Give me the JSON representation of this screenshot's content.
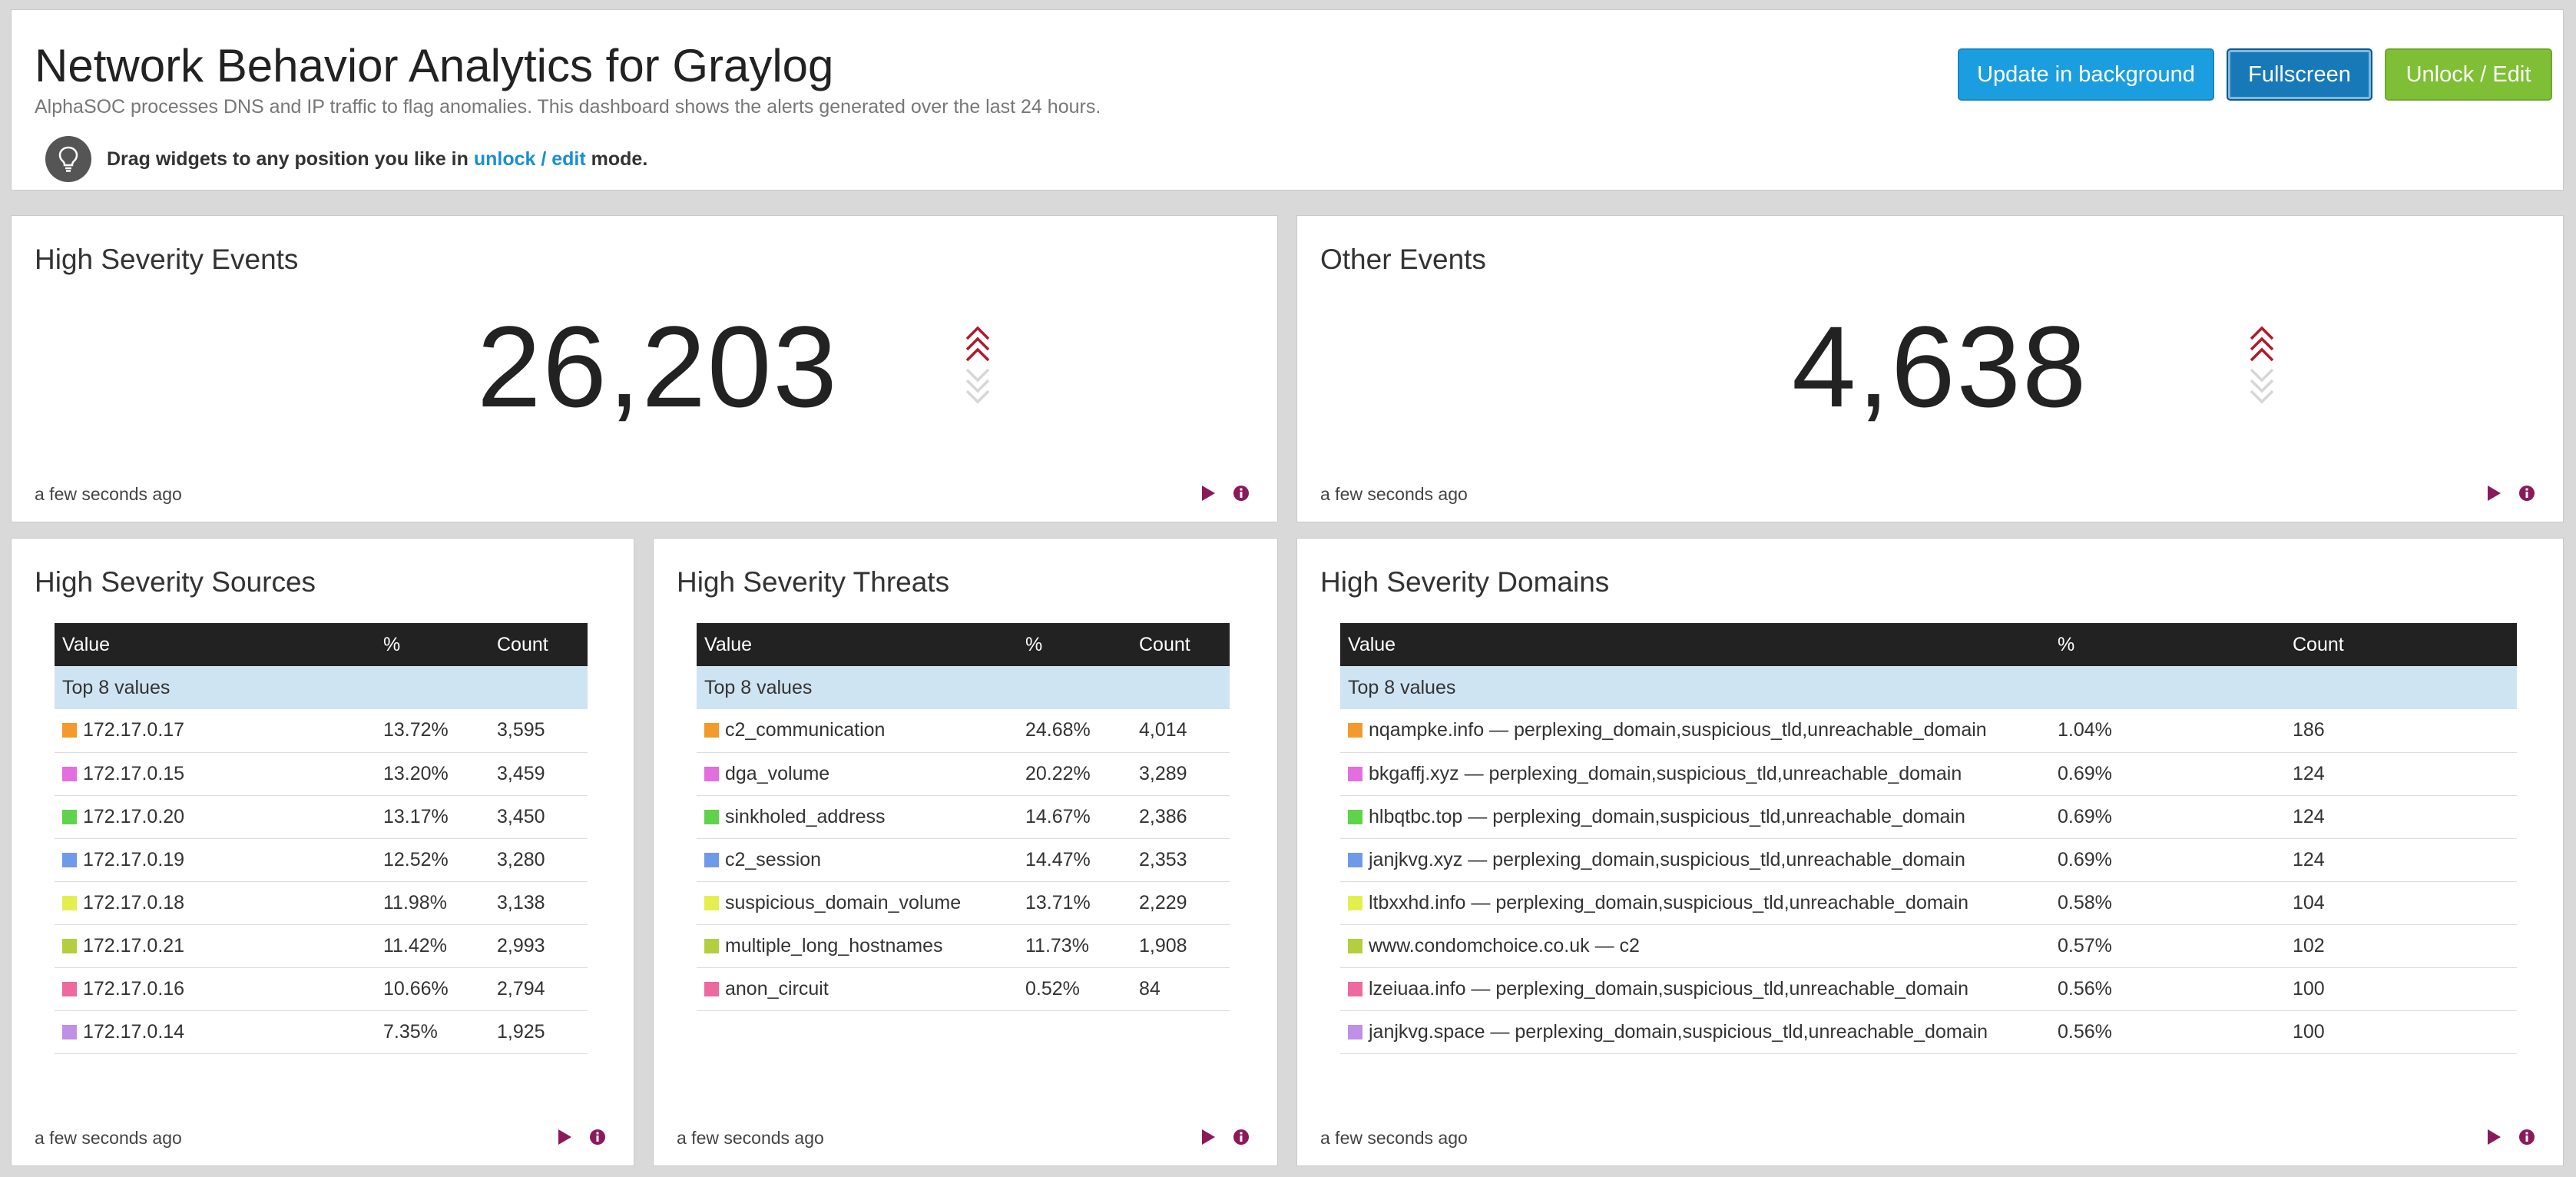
{
  "header": {
    "title": "Network Behavior Analytics for Graylog",
    "subtitle": "AlphaSOC processes DNS and IP traffic to flag anomalies. This dashboard shows the alerts generated over the last 24 hours.",
    "hint_prefix": "Drag widgets to any position you like in ",
    "hint_link": "unlock / edit",
    "hint_suffix": " mode.",
    "buttons": {
      "update": "Update in background",
      "fullscreen": "Fullscreen",
      "unlock": "Unlock / Edit"
    }
  },
  "colors": {
    "trend_up": "#b2182b",
    "action_icon": "#8a1a5a",
    "update_button": "#1b9ee0",
    "fullscreen_button": "#1779b8",
    "unlock_button": "#7fbf35"
  },
  "widgets": {
    "high_severity_events": {
      "title": "High Severity Events",
      "value": "26,203",
      "trend": "up",
      "footer": "a few seconds ago"
    },
    "other_events": {
      "title": "Other Events",
      "value": "4,638",
      "trend": "up",
      "footer": "a few seconds ago"
    },
    "high_severity_sources": {
      "title": "High Severity Sources",
      "columns": [
        "Value",
        "%",
        "Count"
      ],
      "group_label": "Top 8 values",
      "rows": [
        {
          "color": "#f39a2b",
          "value": "172.17.0.17",
          "pct": "13.72%",
          "count": "3,595"
        },
        {
          "color": "#e36ee0",
          "value": "172.17.0.15",
          "pct": "13.20%",
          "count": "3,459"
        },
        {
          "color": "#5fd34b",
          "value": "172.17.0.20",
          "pct": "13.17%",
          "count": "3,450"
        },
        {
          "color": "#6f9ae8",
          "value": "172.17.0.19",
          "pct": "12.52%",
          "count": "3,280"
        },
        {
          "color": "#e4ef4f",
          "value": "172.17.0.18",
          "pct": "11.98%",
          "count": "3,138"
        },
        {
          "color": "#b3cf3e",
          "value": "172.17.0.21",
          "pct": "11.42%",
          "count": "2,993"
        },
        {
          "color": "#ec6a9d",
          "value": "172.17.0.16",
          "pct": "10.66%",
          "count": "2,794"
        },
        {
          "color": "#c08fe6",
          "value": "172.17.0.14",
          "pct": "7.35%",
          "count": "1,925"
        }
      ],
      "footer": "a few seconds ago"
    },
    "high_severity_threats": {
      "title": "High Severity Threats",
      "columns": [
        "Value",
        "%",
        "Count"
      ],
      "group_label": "Top 8 values",
      "rows": [
        {
          "color": "#f39a2b",
          "value": "c2_communication",
          "pct": "24.68%",
          "count": "4,014"
        },
        {
          "color": "#e36ee0",
          "value": "dga_volume",
          "pct": "20.22%",
          "count": "3,289"
        },
        {
          "color": "#5fd34b",
          "value": "sinkholed_address",
          "pct": "14.67%",
          "count": "2,386"
        },
        {
          "color": "#6f9ae8",
          "value": "c2_session",
          "pct": "14.47%",
          "count": "2,353"
        },
        {
          "color": "#e4ef4f",
          "value": "suspicious_domain_volume",
          "pct": "13.71%",
          "count": "2,229"
        },
        {
          "color": "#b3cf3e",
          "value": "multiple_long_hostnames",
          "pct": "11.73%",
          "count": "1,908"
        },
        {
          "color": "#ec6a9d",
          "value": "anon_circuit",
          "pct": "0.52%",
          "count": "84"
        }
      ],
      "footer": "a few seconds ago"
    },
    "high_severity_domains": {
      "title": "High Severity Domains",
      "columns": [
        "Value",
        "%",
        "Count"
      ],
      "group_label": "Top 8 values",
      "rows": [
        {
          "color": "#f39a2b",
          "value": "nqampke.info — perplexing_domain,suspicious_tld,unreachable_domain",
          "pct": "1.04%",
          "count": "186"
        },
        {
          "color": "#e36ee0",
          "value": "bkgaffj.xyz — perplexing_domain,suspicious_tld,unreachable_domain",
          "pct": "0.69%",
          "count": "124"
        },
        {
          "color": "#5fd34b",
          "value": "hlbqtbc.top — perplexing_domain,suspicious_tld,unreachable_domain",
          "pct": "0.69%",
          "count": "124"
        },
        {
          "color": "#6f9ae8",
          "value": "janjkvg.xyz — perplexing_domain,suspicious_tld,unreachable_domain",
          "pct": "0.69%",
          "count": "124"
        },
        {
          "color": "#e4ef4f",
          "value": "ltbxxhd.info — perplexing_domain,suspicious_tld,unreachable_domain",
          "pct": "0.58%",
          "count": "104"
        },
        {
          "color": "#b3cf3e",
          "value": "www.condomchoice.co.uk — c2",
          "pct": "0.57%",
          "count": "102"
        },
        {
          "color": "#ec6a9d",
          "value": "lzeiuaa.info — perplexing_domain,suspicious_tld,unreachable_domain",
          "pct": "0.56%",
          "count": "100"
        },
        {
          "color": "#c08fe6",
          "value": "janjkvg.space — perplexing_domain,suspicious_tld,unreachable_domain",
          "pct": "0.56%",
          "count": "100"
        }
      ],
      "footer": "a few seconds ago"
    }
  }
}
